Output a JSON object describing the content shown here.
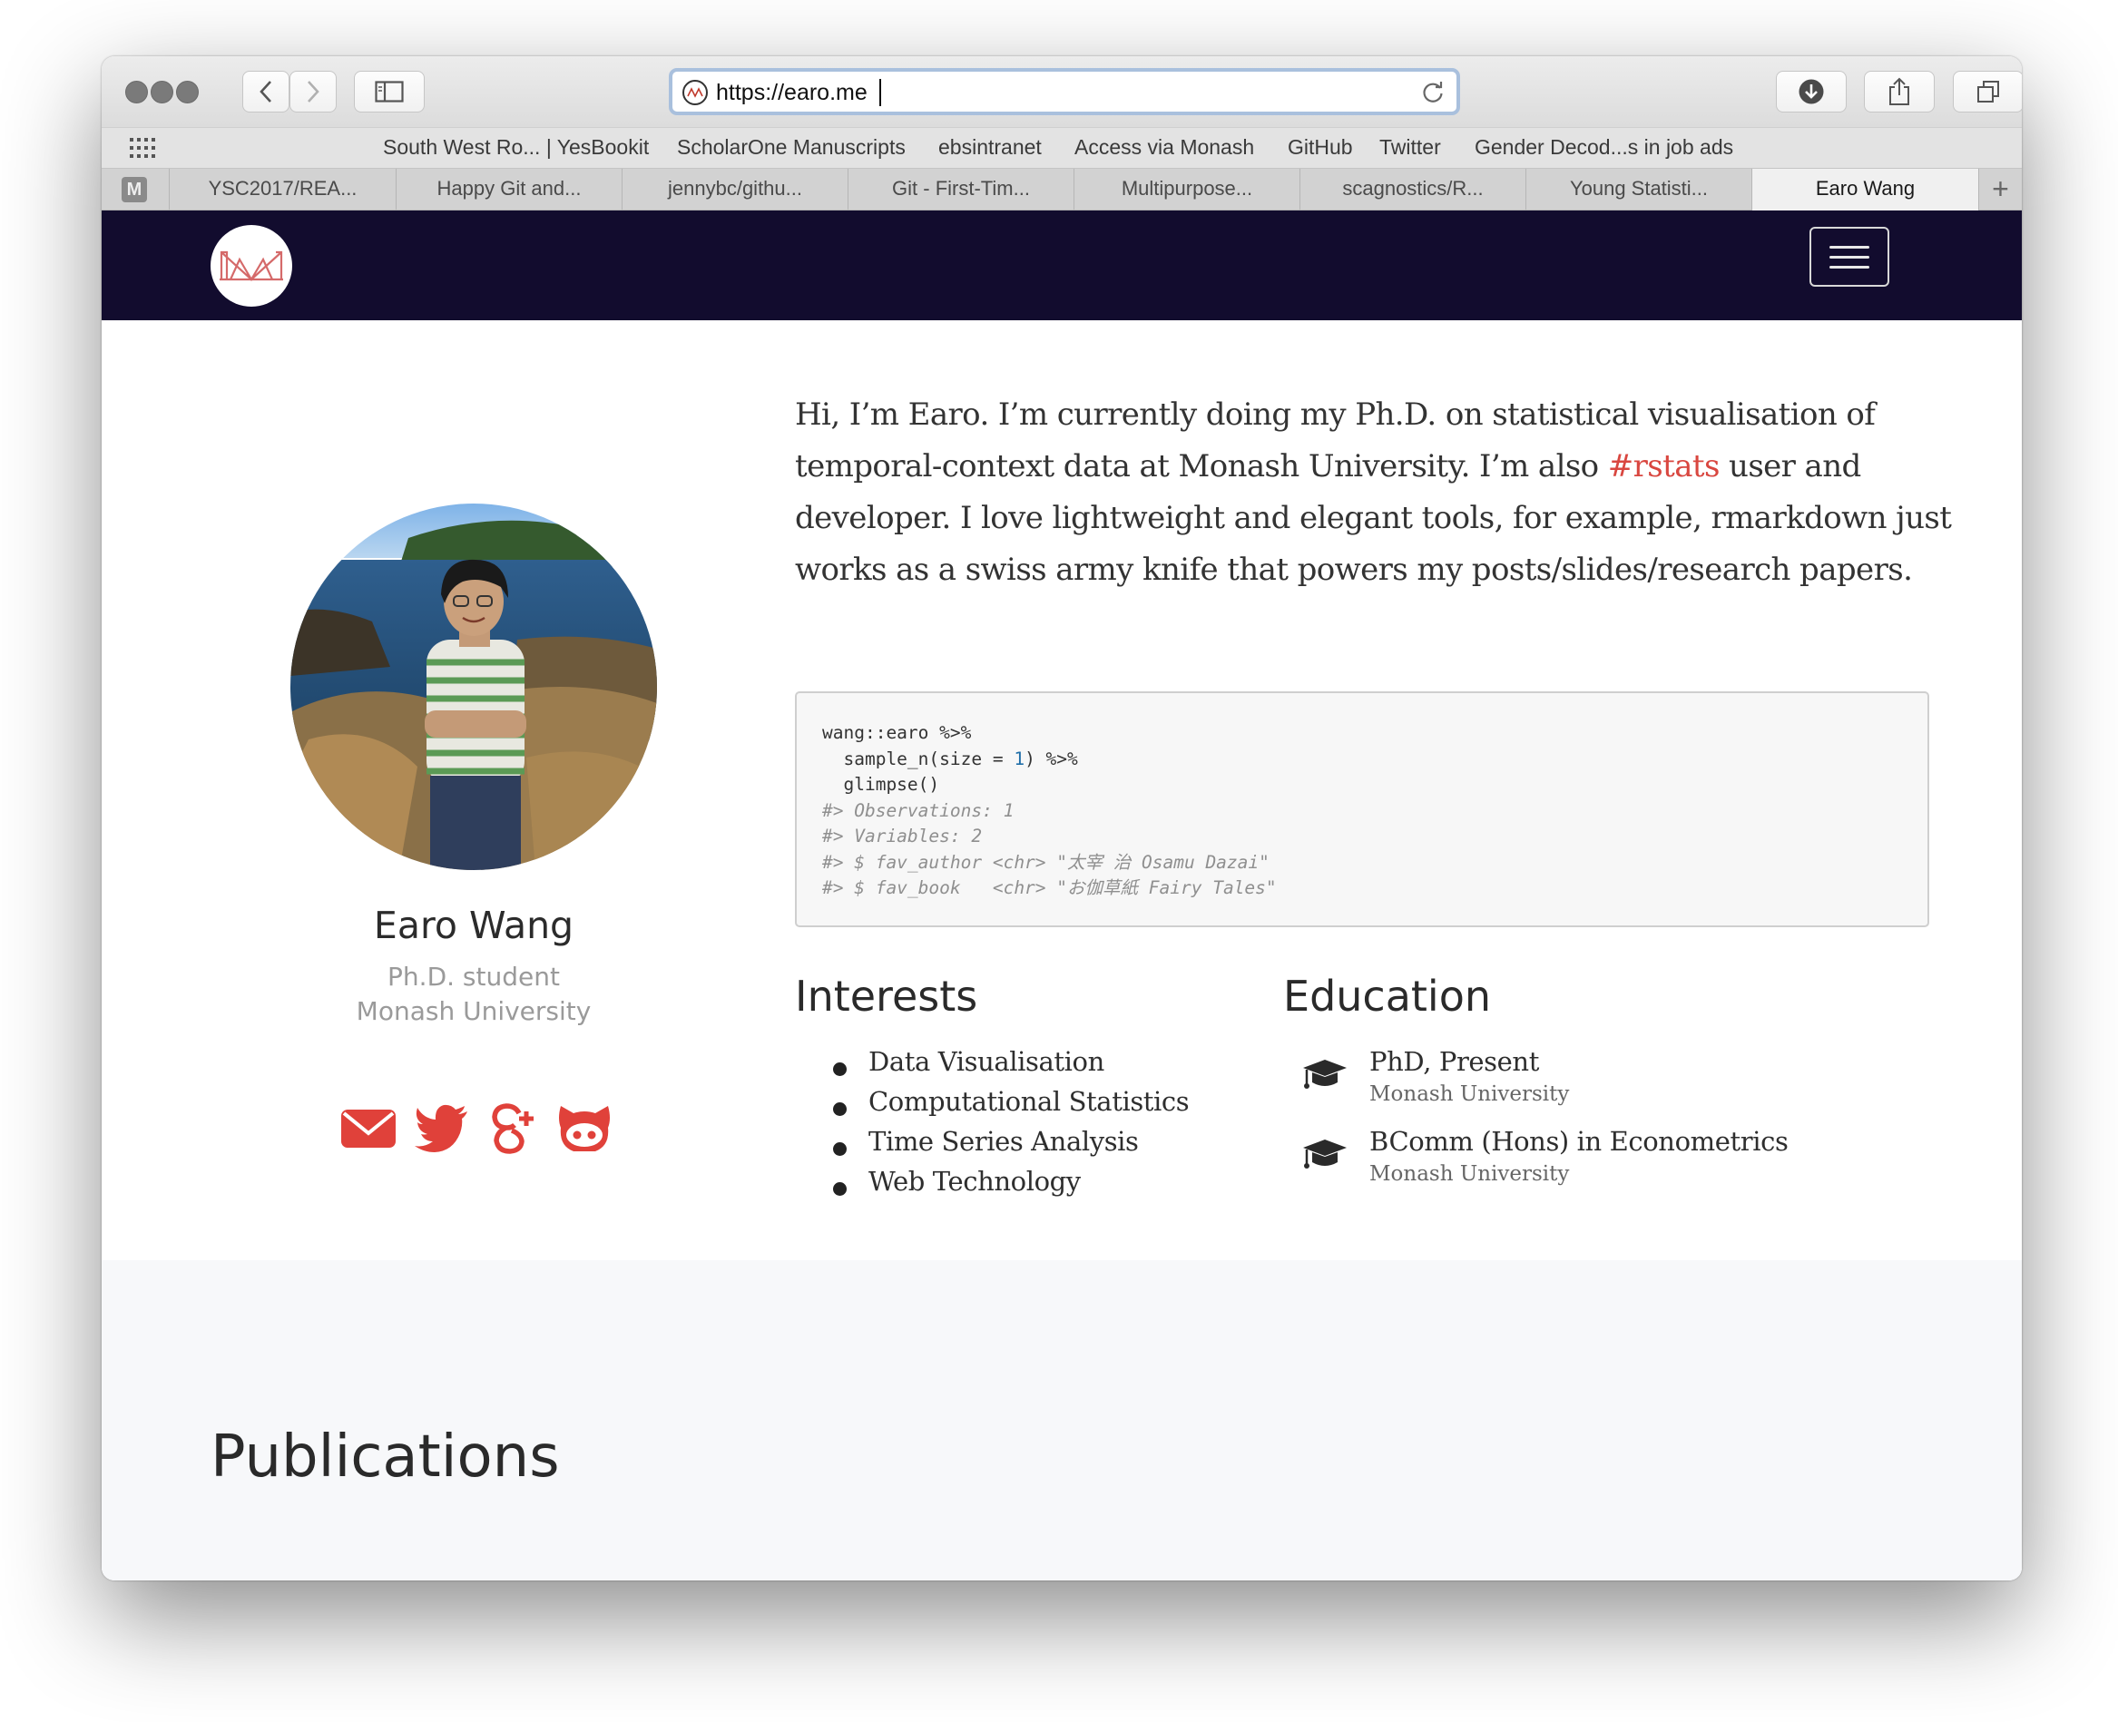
{
  "browser": {
    "url": "https://earo.me",
    "bookmarks": [
      "South West Ro... | YesBookit",
      "ScholarOne Manuscripts",
      "ebsintranet",
      "Access via Monash",
      "GitHub",
      "Twitter",
      "Gender Decod...s in job ads"
    ],
    "pinned_tab_letter": "M",
    "tabs": [
      "YSC2017/REA...",
      "Happy Git and...",
      "jennybc/githu...",
      "Git - First-Tim...",
      "Multipurpose...",
      "scagnostics/R...",
      "Young Statisti...",
      "Earo Wang"
    ],
    "active_tab_index": 7
  },
  "profile": {
    "name": "Earo Wang",
    "role": "Ph.D. student",
    "organization": "Monash University",
    "social_icons": [
      "envelope-icon",
      "twitter-icon",
      "google-plus-icon",
      "github-icon"
    ],
    "accent_color": "#e0413a"
  },
  "bio": {
    "part1": "Hi, I’m Earo. I’m currently doing my Ph.D. on statistical visualisation of temporal-context data at Monash University. I’m also ",
    "link": "#rstats",
    "part2": " user and developer. I love lightweight and elegant tools, for example, rmarkdown just works as a swiss army knife that powers my posts/slides/research papers."
  },
  "code": {
    "line1": "wang::earo %>%",
    "line2_pre": "  sample_n(size = ",
    "line2_num": "1",
    "line2_post": ") %>%",
    "line3": "  glimpse()",
    "line4": "#> Observations: 1",
    "line5": "#> Variables: 2",
    "line6": "#> $ fav_author <chr> \"太宰 治 Osamu Dazai\"",
    "line7": "#> $ fav_book   <chr> \"お伽草紙 Fairy Tales\""
  },
  "interests": {
    "title": "Interests",
    "items": [
      "Data Visualisation",
      "Computational Statistics",
      "Time Series Analysis",
      "Web Technology"
    ]
  },
  "education": {
    "title": "Education",
    "items": [
      {
        "degree": "PhD, Present",
        "institution": "Monash University"
      },
      {
        "degree": "BComm (Hons) in Econometrics",
        "institution": "Monash University"
      }
    ]
  },
  "publications": {
    "title": "Publications"
  },
  "colors": {
    "navbar": "#120c2e",
    "link": "#d94740"
  }
}
